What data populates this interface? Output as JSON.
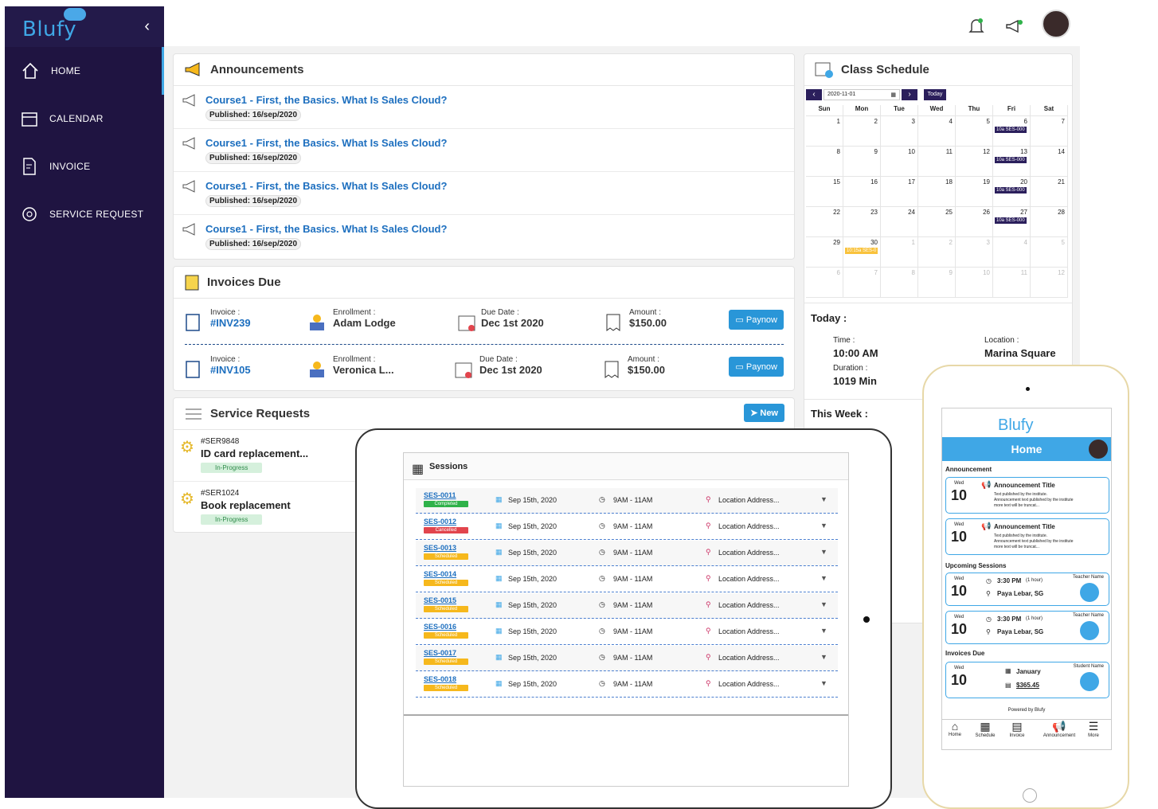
{
  "app": {
    "logo": "Blufy",
    "collapse_icon": "chevron-left-icon"
  },
  "sidebar": {
    "items": [
      {
        "label": "HOME",
        "icon": "home-icon"
      },
      {
        "label": "CALENDAR",
        "icon": "calendar-icon"
      },
      {
        "label": "INVOICE",
        "icon": "invoice-icon"
      },
      {
        "label": "SERVICE REQUEST",
        "icon": "service-request-icon"
      }
    ]
  },
  "announcements": {
    "title": "Announcements",
    "items": [
      {
        "title": "Course1 - First, the Basics. What Is Sales Cloud?",
        "published": "Published: 16/sep/2020"
      },
      {
        "title": "Course1 - First, the Basics. What Is Sales Cloud?",
        "published": "Published: 16/sep/2020"
      },
      {
        "title": "Course1 - First, the Basics. What Is Sales Cloud?",
        "published": "Published: 16/sep/2020"
      },
      {
        "title": "Course1 - First, the Basics. What Is Sales Cloud?",
        "published": "Published: 16/sep/2020"
      }
    ]
  },
  "invoices": {
    "title": "Invoices Due",
    "labels": {
      "invoice": "Invoice :",
      "enrollment": "Enrollment :",
      "due": "Due Date :",
      "amount": "Amount :"
    },
    "paynow": "Paynow",
    "rows": [
      {
        "invoice": "#INV239",
        "enrollment": "Adam Lodge",
        "due": "Dec 1st 2020",
        "amount": "$150.00"
      },
      {
        "invoice": "#INV105",
        "enrollment": "Veronica L...",
        "due": "Dec 1st 2020",
        "amount": "$150.00"
      }
    ]
  },
  "service": {
    "title": "Service Requests",
    "new": "New",
    "rows": [
      {
        "id": "#SER9848",
        "title": "ID card replacement...",
        "status": "In-Progress"
      },
      {
        "id": "#SER1024",
        "title": "Book replacement",
        "status": "In-Progress"
      }
    ]
  },
  "schedule": {
    "title": "Class Schedule",
    "date": "2020-11-01",
    "today_btn": "Today",
    "dow": [
      "Sun",
      "Mon",
      "Tue",
      "Wed",
      "Thu",
      "Fri",
      "Sat"
    ],
    "weeks": [
      [
        "1",
        "2",
        "3",
        "4",
        "5",
        "6",
        "7"
      ],
      [
        "8",
        "9",
        "10",
        "11",
        "12",
        "13",
        "14"
      ],
      [
        "15",
        "16",
        "17",
        "18",
        "19",
        "20",
        "21"
      ],
      [
        "22",
        "23",
        "24",
        "25",
        "26",
        "27",
        "28"
      ],
      [
        "29",
        "30",
        "1",
        "2",
        "3",
        "4",
        "5"
      ],
      [
        "6",
        "7",
        "8",
        "9",
        "10",
        "11",
        "12"
      ]
    ],
    "event": "10a SES-000",
    "event_y": "10:15a SES-0",
    "today_label": "Today :",
    "time_label": "Time :",
    "time": "10:00 AM",
    "location_label": "Location :",
    "location": "Marina Square",
    "duration_label": "Duration :",
    "duration": "1019 Min",
    "week_label": "This Week :"
  },
  "sessions": {
    "title": "Sessions",
    "date": "Sep 15th, 2020",
    "time": "9AM - 11AM",
    "location": "Location Address...",
    "rows": [
      {
        "id": "SES-0011",
        "status": "Completed",
        "color": "#2fb24a"
      },
      {
        "id": "SES-0012",
        "status": "Cancelled",
        "color": "#e2454d"
      },
      {
        "id": "SES-0013",
        "status": "Scheduled",
        "color": "#f6b81c"
      },
      {
        "id": "SES-0014",
        "status": "Scheduled",
        "color": "#f6b81c"
      },
      {
        "id": "SES-0015",
        "status": "Scheduled",
        "color": "#f6b81c"
      },
      {
        "id": "SES-0016",
        "status": "Scheduled",
        "color": "#f6b81c"
      },
      {
        "id": "SES-0017",
        "status": "Scheduled",
        "color": "#f6b81c"
      },
      {
        "id": "SES-0018",
        "status": "Scheduled",
        "color": "#f6b81c"
      }
    ]
  },
  "phone": {
    "logo": "Blufy",
    "header": "Home",
    "ann_label": "Announcement",
    "wed": "Wed",
    "day": "10",
    "ann_title": "Announcement Title",
    "ann_text1": "Text published by the institute.",
    "ann_text2": "Announcement text published by the institute",
    "ann_text3": "more text will be truncat...",
    "upcoming": "Upcoming Sessions",
    "teacher": "Teacher Name",
    "s1_time": "3:30 PM",
    "s1_dur": "(1 hour)",
    "s2_time": "3:30 PM",
    "s2_dur": "(1 hour)",
    "s_loc": "Paya Lebar, SG",
    "inv_label": "Invoices Due",
    "student": "Student Name",
    "inv_month": "January",
    "inv_amount": "$365.45",
    "powered": "Powered by Blufy",
    "tabs": [
      "Home",
      "Schedule",
      "Invoice",
      "Announcement",
      "More"
    ]
  }
}
